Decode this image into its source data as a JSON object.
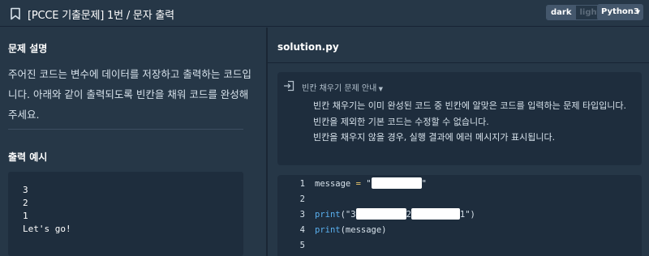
{
  "header": {
    "title": "[PCCE 기출문제] 1번 / 문자 출력",
    "bookmark_icon": "bookmark-icon",
    "theme_dark": "dark",
    "theme_light": "light",
    "language": "Python3"
  },
  "left": {
    "problem_title": "문제 설명",
    "description": "주어진 코드는 변수에 데이터를 저장하고 출력하는 코드입니다. 아래와 같이 출력되도록 빈칸을 채워 코드를 완성해 주세요.",
    "output_title": "출력 예시",
    "output_lines": [
      "3",
      "2",
      "1",
      "Let's go!"
    ]
  },
  "right": {
    "file_name": "solution.py",
    "notice": {
      "icon": "enter-icon",
      "heading": "빈칸 채우기 문제 안내",
      "lines": [
        "빈칸 채우기는 이미 완성된 코드 중 빈칸에 알맞은 코드를 입력하는 문제 타입입니다.",
        "빈칸을 제외한 기본 코드는 수정할 수 없습니다.",
        "빈칸을 채우지 않을 경우, 실행 결과에 에러 메시지가 표시됩니다."
      ]
    },
    "code": {
      "line_numbers": [
        "1",
        "2",
        "3",
        "4",
        "5"
      ],
      "line1_var": "message",
      "line1_eq": "=",
      "quote": "\"",
      "line3_fn": "print",
      "line3_open": "(\"3",
      "line3_mid": "2",
      "line3_end": "1\")",
      "line4_fn": "print",
      "line4_arg": "(message)"
    }
  }
}
